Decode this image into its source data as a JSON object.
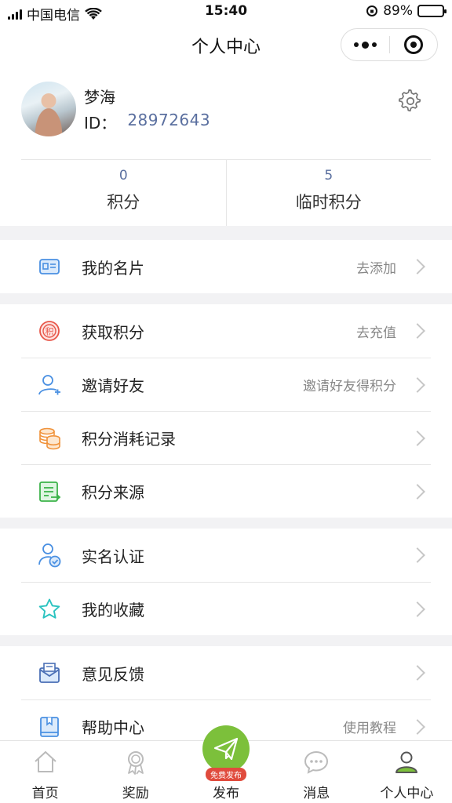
{
  "status_bar": {
    "carrier": "中国电信",
    "time": "15:40",
    "battery": "89%",
    "battery_level": 0.89
  },
  "nav": {
    "title": "个人中心"
  },
  "profile": {
    "name": "梦海",
    "id_label": "ID：",
    "id_value": "28972643"
  },
  "stats": [
    {
      "value": "0",
      "label": "积分"
    },
    {
      "value": "5",
      "label": "临时积分"
    }
  ],
  "groups": [
    [
      {
        "icon": "business-card-icon",
        "label": "我的名片",
        "hint": "去添加"
      }
    ],
    [
      {
        "icon": "points-icon",
        "label": "获取积分",
        "hint": "去充值"
      },
      {
        "icon": "invite-user-icon",
        "label": "邀请好友",
        "hint": "邀请好友得积分"
      },
      {
        "icon": "coins-icon",
        "label": "积分消耗记录",
        "hint": ""
      },
      {
        "icon": "points-source-icon",
        "label": "积分来源",
        "hint": ""
      }
    ],
    [
      {
        "icon": "verified-user-icon",
        "label": "实名认证",
        "hint": ""
      },
      {
        "icon": "star-icon",
        "label": "我的收藏",
        "hint": ""
      }
    ],
    [
      {
        "icon": "feedback-mail-icon",
        "label": "意见反馈",
        "hint": ""
      },
      {
        "icon": "help-book-icon",
        "label": "帮助中心",
        "hint": "使用教程"
      }
    ]
  ],
  "tabs": [
    {
      "icon": "home-icon",
      "label": "首页"
    },
    {
      "icon": "award-icon",
      "label": "奖励"
    },
    {
      "icon": "publish-icon",
      "label": "发布",
      "badge": "免费发布"
    },
    {
      "icon": "message-icon",
      "label": "消息"
    },
    {
      "icon": "profile-icon",
      "label": "个人中心"
    }
  ],
  "colors": {
    "accent_blue": "#5a6f9f",
    "publish_green": "#7cc03b",
    "badge_red": "#e04b3d"
  }
}
